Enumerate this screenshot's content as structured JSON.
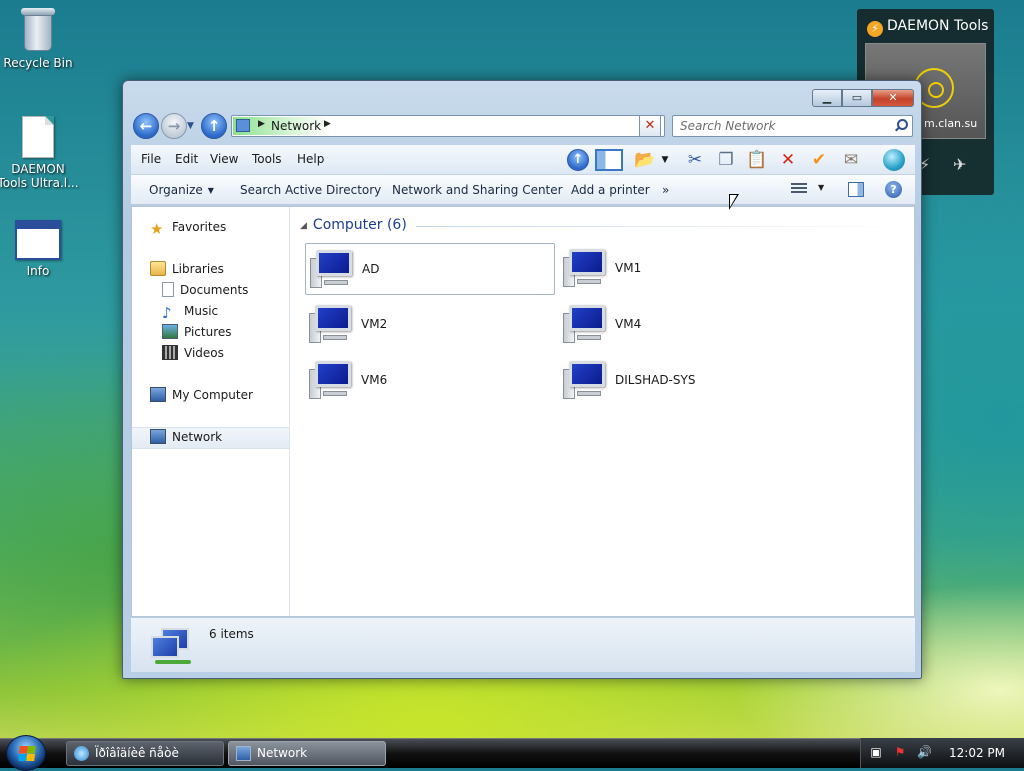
{
  "desktop": {
    "icons": [
      {
        "label": "Recycle Bin",
        "icon": "recycle-bin-icon"
      },
      {
        "label": "DAEMON Tools Ultra.l...",
        "icon": "document-icon"
      },
      {
        "label": "Info",
        "icon": "window-icon"
      }
    ]
  },
  "gadget": {
    "title": "DAEMON Tools",
    "site": "m.clan.su"
  },
  "window": {
    "address": {
      "crumb": "Network"
    },
    "search": {
      "placeholder": "Search Network"
    },
    "menu": {
      "file": "File",
      "edit": "Edit",
      "view": "View",
      "tools": "Tools",
      "help": "Help"
    },
    "commands": {
      "organize": "Organize",
      "search_ad": "Search Active Directory",
      "network_center": "Network and Sharing Center",
      "add_printer": "Add a printer",
      "more": "»"
    },
    "nav_pane": {
      "favorites": "Favorites",
      "libraries": "Libraries",
      "documents": "Documents",
      "music": "Music",
      "pictures": "Pictures",
      "videos": "Videos",
      "my_computer": "My Computer",
      "network": "Network"
    },
    "group": {
      "label": "Computer (6)"
    },
    "computers": [
      "AD",
      "VM1",
      "VM2",
      "VM4",
      "VM6",
      "DILSHAD-SYS"
    ],
    "details": {
      "count": "6 items"
    }
  },
  "taskbar": {
    "buttons": [
      {
        "label": "Ïðîâîäíèê ñåòè",
        "active": false
      },
      {
        "label": "Network",
        "active": true
      }
    ],
    "clock": "12:02 PM"
  },
  "colors": {
    "accent": "#1e3d8f",
    "close_button": "#c5422a",
    "taskbar": "#111111"
  }
}
